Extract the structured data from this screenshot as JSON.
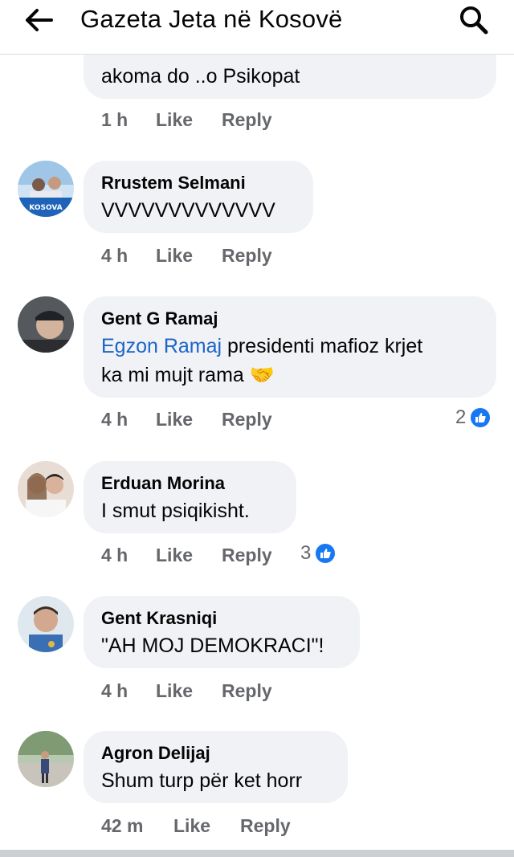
{
  "header": {
    "title": "Gazeta Jeta në Kosovë",
    "back_icon": "arrow-left-icon",
    "search_icon": "search-icon"
  },
  "actions": {
    "like": "Like",
    "reply": "Reply"
  },
  "colors": {
    "bubble": "#f0f2f5",
    "meta_text": "#65676b",
    "mention": "#1b65c8",
    "like_badge": "#1877f2"
  },
  "comments": [
    {
      "author": "",
      "text_lines": [
        "akoma do ..o Psikopat"
      ],
      "time": "1 h",
      "reactions": null
    },
    {
      "author": "Rrustem Selmani",
      "text_lines": [
        "VVVVVVVVVVVVV"
      ],
      "time": "4 h",
      "reactions": null,
      "avatar_caption": "KOSOVA"
    },
    {
      "author": "Gent G Ramaj",
      "mention": "Egzon Ramaj",
      "text_lines": [
        "presidenti mafioz krjet",
        "ka mi mujt rama"
      ],
      "emoji": "🤝",
      "time": "4 h",
      "reactions": "2"
    },
    {
      "author": "Erduan Morina",
      "text_lines": [
        "I smut psiqikisht."
      ],
      "time": "4 h",
      "reactions": "3"
    },
    {
      "author": "Gent Krasniqi",
      "text_lines": [
        "\"AH MOJ DEMOKRACI\"!"
      ],
      "time": "4 h",
      "reactions": null
    },
    {
      "author": "Agron Delijaj",
      "text_lines": [
        "Shum turp për ket horr"
      ],
      "time": "42 m",
      "reactions": null
    }
  ]
}
